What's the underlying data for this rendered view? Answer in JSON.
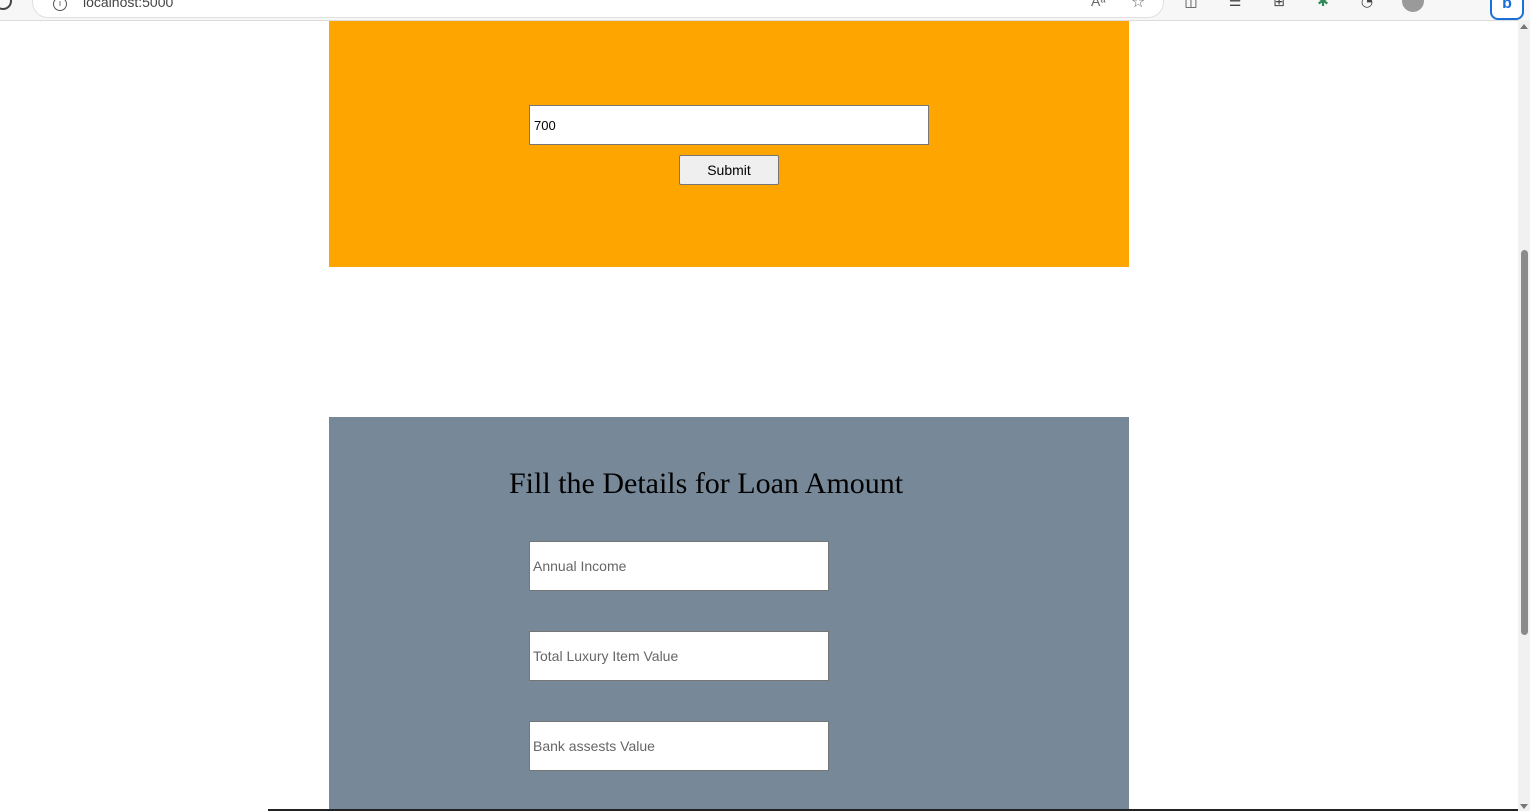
{
  "browser": {
    "url": "localhost:5000",
    "read_aloud_label": "Aᵃ",
    "icons": [
      "reload-icon",
      "info-icon",
      "read-aloud-icon",
      "favorite-star-icon",
      "split-screen-icon",
      "favorites-list-icon",
      "collections-icon",
      "extensions-icon",
      "notifications-icon",
      "profile-icon",
      "more-icon",
      "bing-chat-icon"
    ]
  },
  "orange_section": {
    "heading": "",
    "input_value": "700",
    "submit_label": "Submit",
    "color": "#ffa500"
  },
  "loan_section": {
    "title": "Fill the Details for Loan Amount",
    "color": "#778899",
    "fields": [
      {
        "placeholder": "Annual Income"
      },
      {
        "placeholder": "Total Luxury Item Value"
      },
      {
        "placeholder": "Bank assests Value"
      }
    ]
  }
}
